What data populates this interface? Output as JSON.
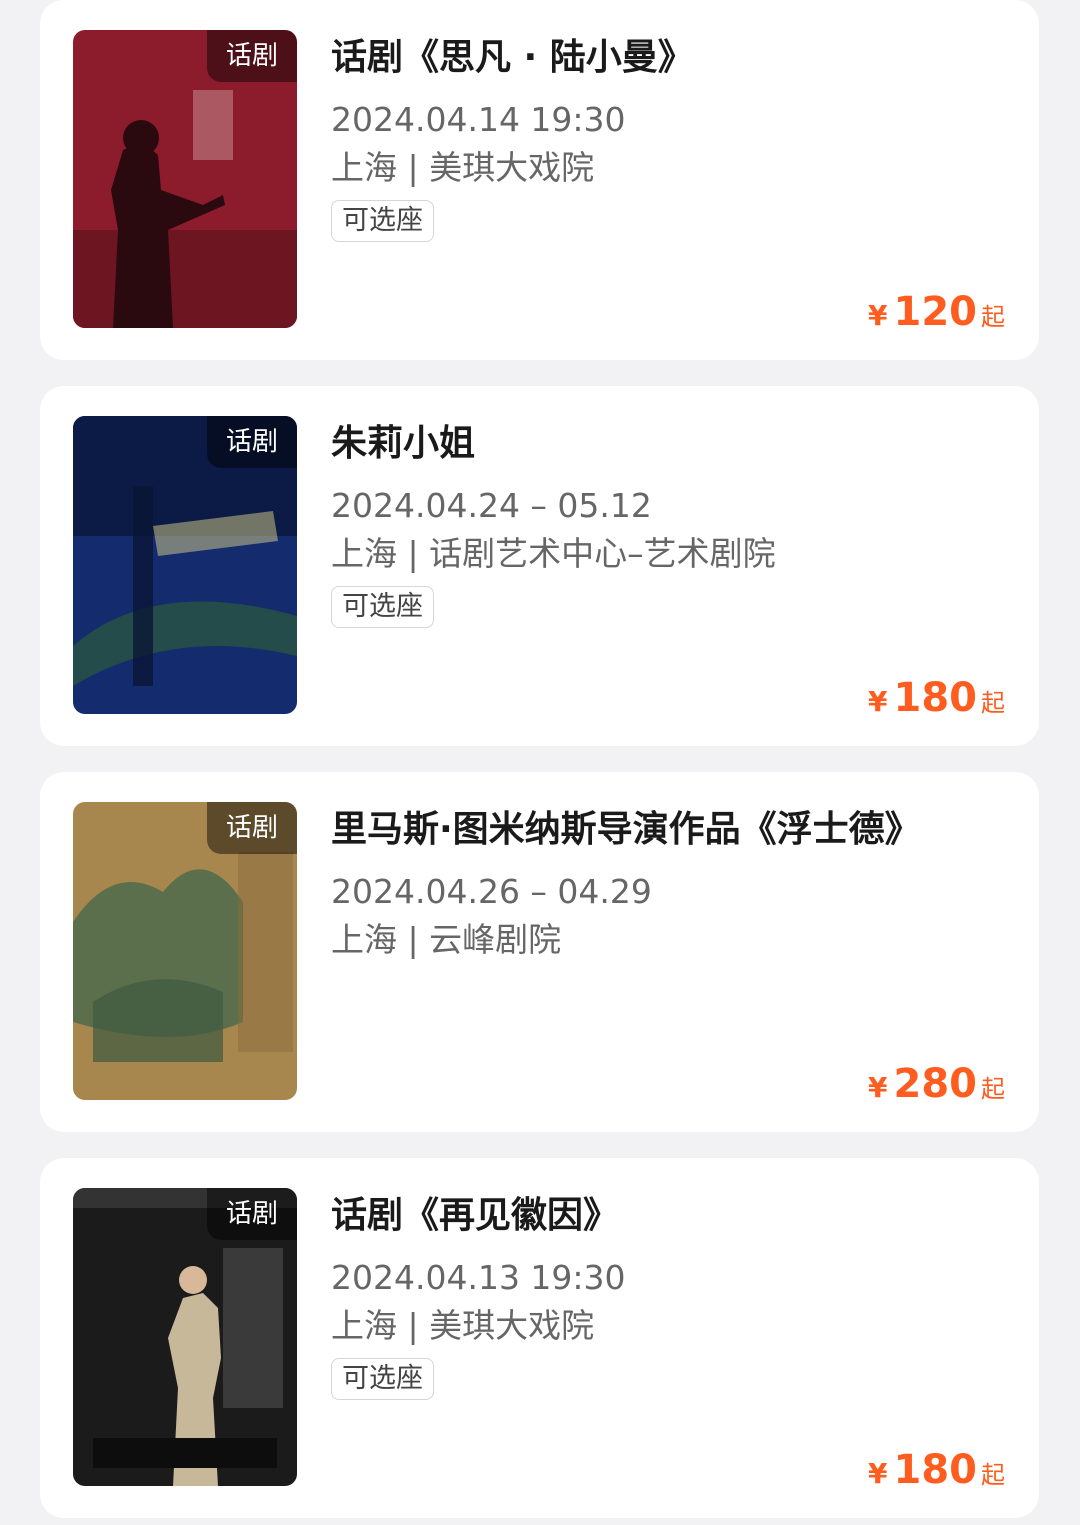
{
  "items": [
    {
      "tag": "话剧",
      "title": "话剧《思凡 · 陆小曼》",
      "date": "2024.04.14 19:30",
      "venue": "上海 | 美琪大戏院",
      "seat_label": "可选座",
      "currency": "¥",
      "price": "120",
      "price_suffix": "起",
      "poster_colors": {
        "bg": "#8c1c2c",
        "accent": "#5a0f18"
      }
    },
    {
      "tag": "话剧",
      "title": "朱莉小姐",
      "date": "2024.04.24 – 05.12",
      "venue": "上海 | 话剧艺术中心–艺术剧院",
      "seat_label": "可选座",
      "currency": "¥",
      "price": "180",
      "price_suffix": "起",
      "poster_colors": {
        "bg": "#142c6e",
        "accent": "#0c1b45"
      }
    },
    {
      "tag": "话剧",
      "title": "里马斯·图米纳斯导演作品《浮士德》",
      "date": "2024.04.26 – 04.29",
      "venue": "上海 | 云峰剧院",
      "seat_label": "",
      "currency": "¥",
      "price": "280",
      "price_suffix": "起",
      "poster_colors": {
        "bg": "#a8874e",
        "accent": "#4f6b4d"
      }
    },
    {
      "tag": "话剧",
      "title": "话剧《再见徽因》",
      "date": "2024.04.13 19:30",
      "venue": "上海 | 美琪大戏院",
      "seat_label": "可选座",
      "currency": "¥",
      "price": "180",
      "price_suffix": "起",
      "poster_colors": {
        "bg": "#1b1b1b",
        "accent": "#3a3a3a"
      }
    }
  ]
}
